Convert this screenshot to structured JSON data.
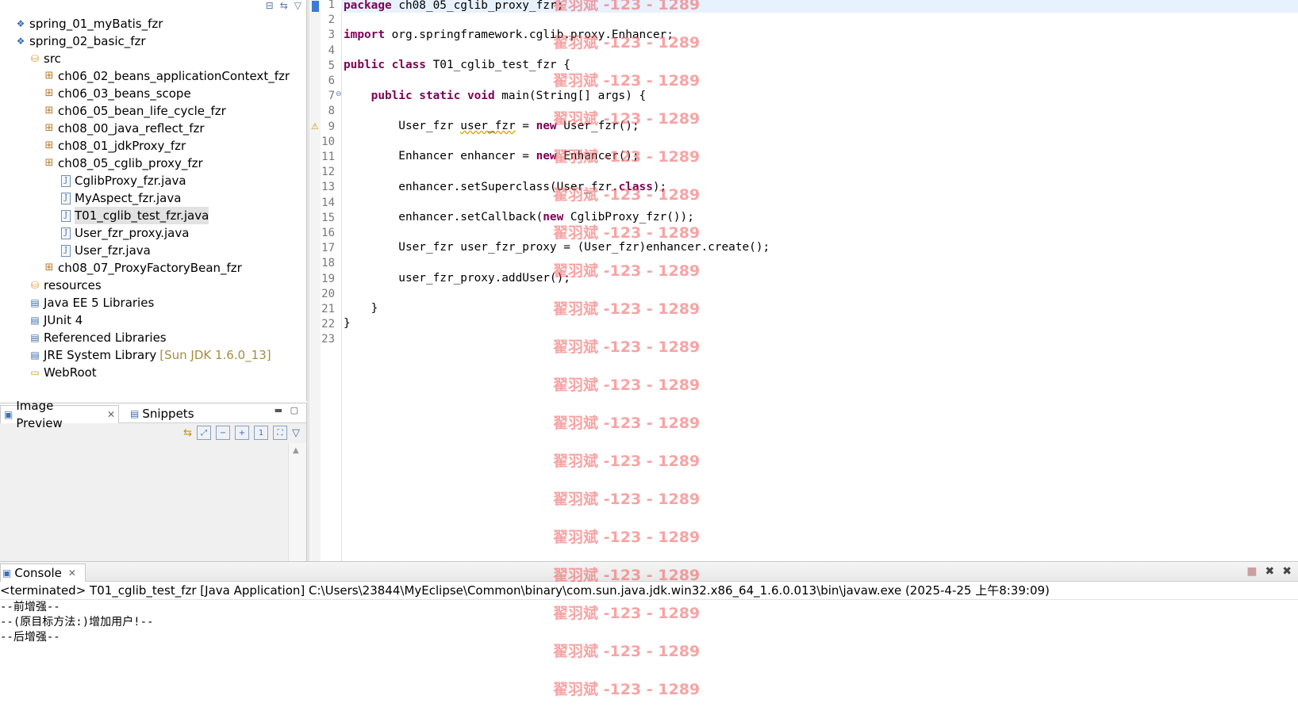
{
  "explorer": {
    "tree": [
      {
        "label": "spring_01_myBatis_fzr",
        "icon": "project-icon"
      },
      {
        "label": "spring_02_basic_fzr",
        "icon": "project-icon"
      },
      {
        "label": "src",
        "icon": "source-folder-icon"
      },
      {
        "label": "ch06_02_beans_applicationContext_fzr",
        "icon": "package-icon"
      },
      {
        "label": "ch06_03_beans_scope",
        "icon": "package-icon"
      },
      {
        "label": "ch06_05_bean_life_cycle_fzr",
        "icon": "package-icon"
      },
      {
        "label": "ch08_00_java_reflect_fzr",
        "icon": "package-icon"
      },
      {
        "label": "ch08_01_jdkProxy_fzr",
        "icon": "package-icon"
      },
      {
        "label": "ch08_05_cglib_proxy_fzr",
        "icon": "package-icon"
      },
      {
        "label": "CglibProxy_fzr.java",
        "icon": "java-file-icon"
      },
      {
        "label": "MyAspect_fzr.java",
        "icon": "java-file-icon"
      },
      {
        "label": "T01_cglib_test_fzr.java",
        "icon": "java-file-icon",
        "selected": true
      },
      {
        "label": "User_fzr_proxy.java",
        "icon": "java-file-icon"
      },
      {
        "label": "User_fzr.java",
        "icon": "java-file-icon"
      },
      {
        "label": "ch08_07_ProxyFactoryBean_fzr",
        "icon": "package-icon"
      },
      {
        "label": "resources",
        "icon": "source-folder-icon"
      },
      {
        "label": "Java EE 5 Libraries",
        "icon": "library-icon"
      },
      {
        "label": "JUnit 4",
        "icon": "library-icon"
      },
      {
        "label": "Referenced Libraries",
        "icon": "library-icon"
      },
      {
        "label": "JRE System Library",
        "icon": "library-icon",
        "extra": "[Sun JDK 1.6.0_13]"
      },
      {
        "label": "WebRoot",
        "icon": "folder-icon"
      }
    ]
  },
  "preview": {
    "tab_image_preview": "Image Preview",
    "tab_snippets": "Snippets"
  },
  "editor": {
    "line_numbers": [
      "1",
      "2",
      "3",
      "4",
      "5",
      "6",
      "7",
      "8",
      "9",
      "10",
      "11",
      "12",
      "13",
      "14",
      "15",
      "16",
      "17",
      "18",
      "19",
      "20",
      "21",
      "22",
      "23"
    ],
    "l1_kw": "package",
    "l1_rest": " ch08_05_cglib_proxy_fzr;",
    "l3_kw": "import",
    "l3_rest": " org.springframework.cglib.proxy.Enhancer;",
    "l5_kw": "public class",
    "l5_rest": " T01_cglib_test_fzr {",
    "l7_indent": "    ",
    "l7_kw": "public static void",
    "l7_rest": " main(String[] args) {",
    "l9_a": "        User_fzr ",
    "l9_var": "user_fzr",
    "l9_b": " = ",
    "l9_kw": "new",
    "l9_c": " User_fzr();",
    "l11_a": "        Enhancer enhancer = ",
    "l11_kw": "new",
    "l11_c": " Enhancer();",
    "l13_a": "        enhancer.setSuperclass(User_fzr.",
    "l13_kw": "class",
    "l13_c": ");",
    "l15_a": "        enhancer.setCallback(",
    "l15_kw": "new",
    "l15_c": " CglibProxy_fzr());",
    "l17": "        User_fzr user_fzr_proxy = (User_fzr)enhancer.create();",
    "l19": "        user_fzr_proxy.addUser();",
    "l21": "    }",
    "l22": "}"
  },
  "console": {
    "tab_label": "Console",
    "status": "<terminated> T01_cglib_test_fzr [Java Application] C:\\Users\\23844\\MyEclipse\\Common\\binary\\com.sun.java.jdk.win32.x86_64_1.6.0.013\\bin\\javaw.exe (2025-4-25 上午8:39:09)",
    "output": [
      "--前增强--",
      "--(原目标方法:)增加用户!--",
      "--后增强--"
    ]
  },
  "watermark": {
    "text": "翟羽斌 -123 - 1289"
  }
}
